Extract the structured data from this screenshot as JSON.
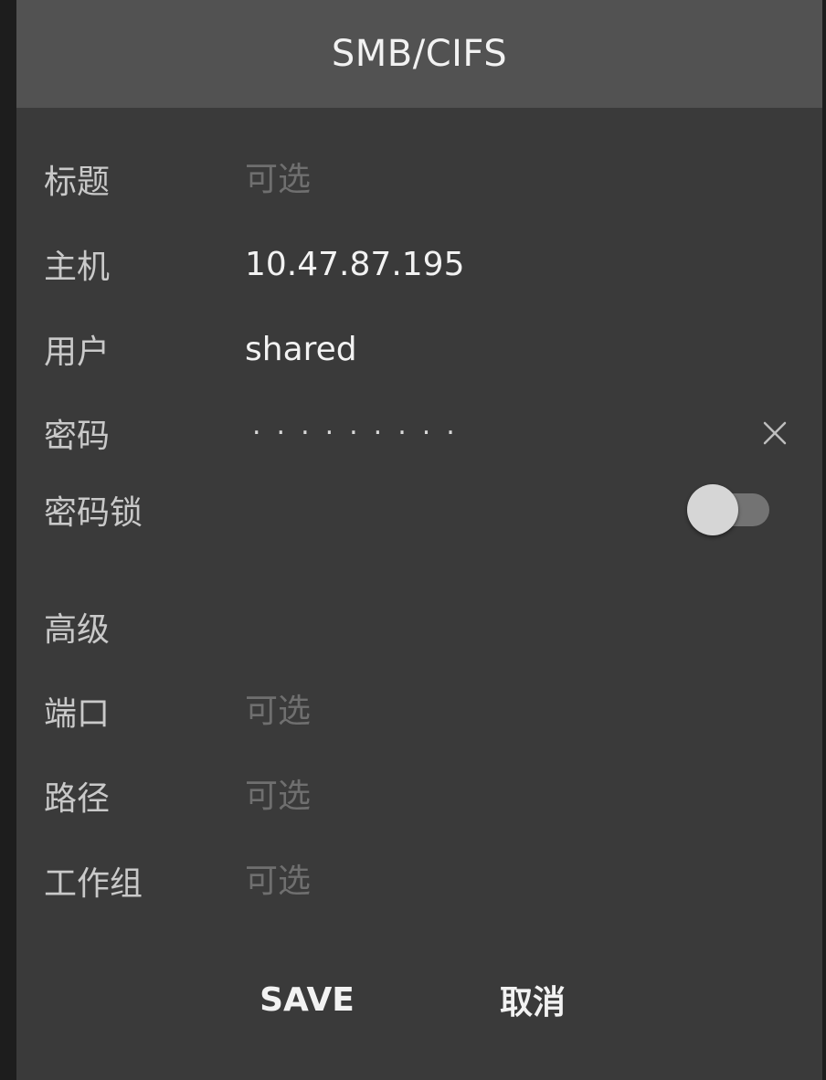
{
  "dialog": {
    "title": "SMB/CIFS"
  },
  "form": {
    "title": {
      "label": "标题",
      "value": "",
      "placeholder": "可选"
    },
    "host": {
      "label": "主机",
      "value": "10.47.87.195"
    },
    "user": {
      "label": "用户",
      "value": "shared"
    },
    "password": {
      "label": "密码",
      "masked_value": "·········",
      "clear_icon": "close-icon"
    },
    "password_lock": {
      "label": "密码锁",
      "enabled": false
    },
    "advanced": {
      "heading": "高级",
      "port": {
        "label": "端口",
        "value": "",
        "placeholder": "可选"
      },
      "path": {
        "label": "路径",
        "value": "",
        "placeholder": "可选"
      },
      "workgroup": {
        "label": "工作组",
        "value": "",
        "placeholder": "可选"
      }
    }
  },
  "actions": {
    "save_label": "SAVE",
    "cancel_label": "取消"
  },
  "colors": {
    "dialog_bg": "#3a3a3a",
    "header_bg": "#525252",
    "text_primary": "#f2f2f2",
    "text_label": "#c9c9c9",
    "text_placeholder": "#6f6f6f"
  }
}
